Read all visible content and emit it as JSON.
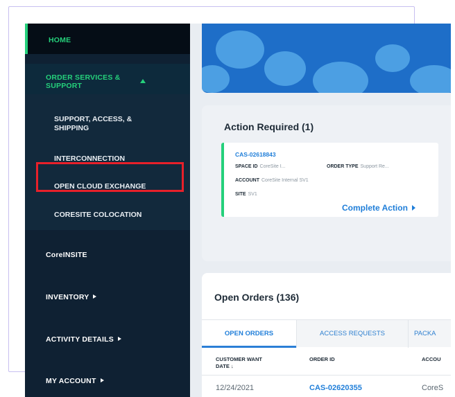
{
  "sidebar": {
    "home": "HOME",
    "order_services": "ORDER SERVICES & SUPPORT",
    "submenu": [
      "SUPPORT, ACCESS, & SHIPPING",
      "INTERCONNECTION",
      "OPEN CLOUD EXCHANGE",
      "CORESITE COLOCATION"
    ],
    "coreinsite": "CoreINSITE",
    "inventory": "INVENTORY",
    "activity_details": "ACTIVITY DETAILS",
    "my_account": "MY ACCOUNT"
  },
  "action_required": {
    "title": "Action Required (1)",
    "case_id": "CAS-02618843",
    "space_id_label": "SPACE ID",
    "space_id_value": "CoreSite I...",
    "order_type_label": "ORDER TYPE",
    "order_type_value": "Support Re...",
    "account_label": "ACCOUNT",
    "account_value": "CoreSite Internal  SV1",
    "site_label": "SITE",
    "site_value": "SV1",
    "complete_action": "Complete Action"
  },
  "open_orders": {
    "title": "Open Orders (136)",
    "tabs": [
      "OPEN ORDERS",
      "ACCESS REQUESTS",
      "PACKA"
    ],
    "columns": [
      "CUSTOMER WANT DATE ↓",
      "ORDER ID",
      "ACCOU"
    ],
    "rows": [
      {
        "date": "12/24/2021",
        "order_id": "CAS-02620355",
        "account": "CoreS"
      }
    ]
  },
  "colors": {
    "sidebar_bg": "#0f2133",
    "accent_green": "#25d07b",
    "link_blue": "#1f7ed9",
    "highlight_red": "#e8202a"
  }
}
